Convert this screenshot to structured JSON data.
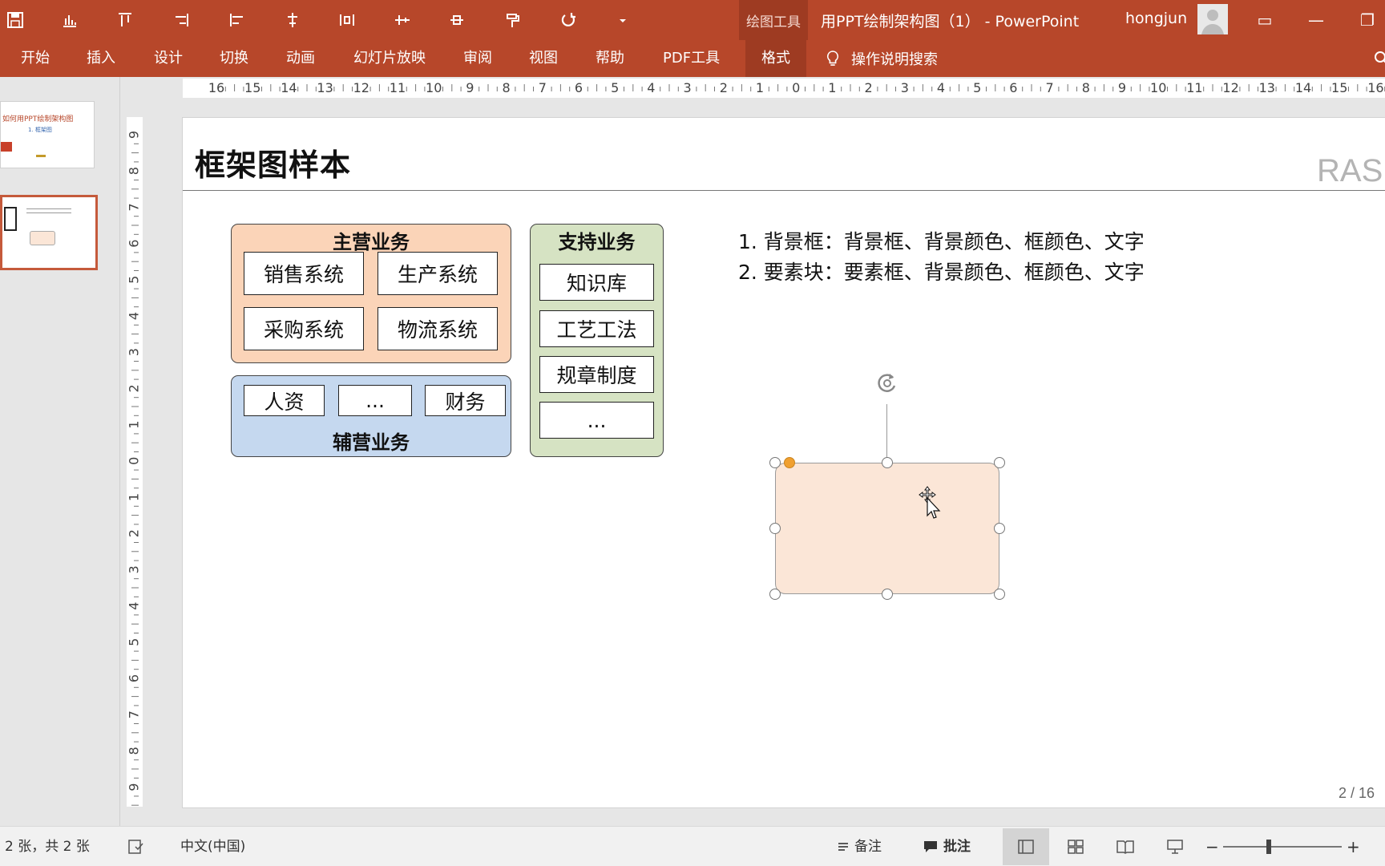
{
  "window": {
    "context_tab": "绘图工具",
    "doc_title": "用PPT绘制架构图（1） -  PowerPoint",
    "username": "hongjun"
  },
  "ribbon": {
    "tabs": [
      "开始",
      "插入",
      "设计",
      "切换",
      "动画",
      "幻灯片放映",
      "审阅",
      "视图",
      "帮助",
      "PDF工具",
      "格式"
    ],
    "active_tab": "格式",
    "tell_me": "操作说明搜索"
  },
  "thumbnails": {
    "slide1_title": "如何用PPT绘制架构图",
    "slide1_sub": "1. 框架图"
  },
  "rulers": {
    "h_labels": [
      "16",
      "15",
      "14",
      "13",
      "12",
      "11",
      "10",
      "9",
      "8",
      "7",
      "6",
      "5",
      "4",
      "3",
      "2",
      "1",
      "0",
      "1",
      "2",
      "3",
      "4",
      "5",
      "6",
      "7",
      "8",
      "9",
      "10",
      "11",
      "12",
      "13",
      "14",
      "15",
      "16"
    ],
    "v_labels": [
      "9",
      "8",
      "7",
      "6",
      "5",
      "4",
      "3",
      "2",
      "1",
      "0",
      "1",
      "2",
      "3",
      "4",
      "5",
      "6",
      "7",
      "8",
      "9"
    ]
  },
  "slide": {
    "title": "框架图样本",
    "watermark": "RASD",
    "main_panel": {
      "title": "主营业务",
      "items": [
        "销售系统",
        "生产系统",
        "采购系统",
        "物流系统"
      ]
    },
    "aux_panel": {
      "title": "辅营业务",
      "items": [
        "人资",
        "...",
        "财务"
      ]
    },
    "support_panel": {
      "title": "支持业务",
      "items": [
        "知识库",
        "工艺工法",
        "规章制度",
        "..."
      ]
    },
    "notes": [
      "1. 背景框：背景框、背景颜色、框颜色、文字",
      "2. 要素块：要素框、背景颜色、框颜色、文字"
    ],
    "page_indicator": "2 / 16",
    "colors": {
      "main_fill": "#fbd4b8",
      "aux_fill": "#c5d8ef",
      "support_fill": "#d6e3c3",
      "selected_shape_fill": "#fbe6d7"
    }
  },
  "statusbar": {
    "slide_count": "2 张，共 2 张",
    "language": "中文(中国)",
    "notes_label": "备注",
    "comments_label": "批注",
    "zoom_minus": "−",
    "zoom_plus": "+"
  }
}
